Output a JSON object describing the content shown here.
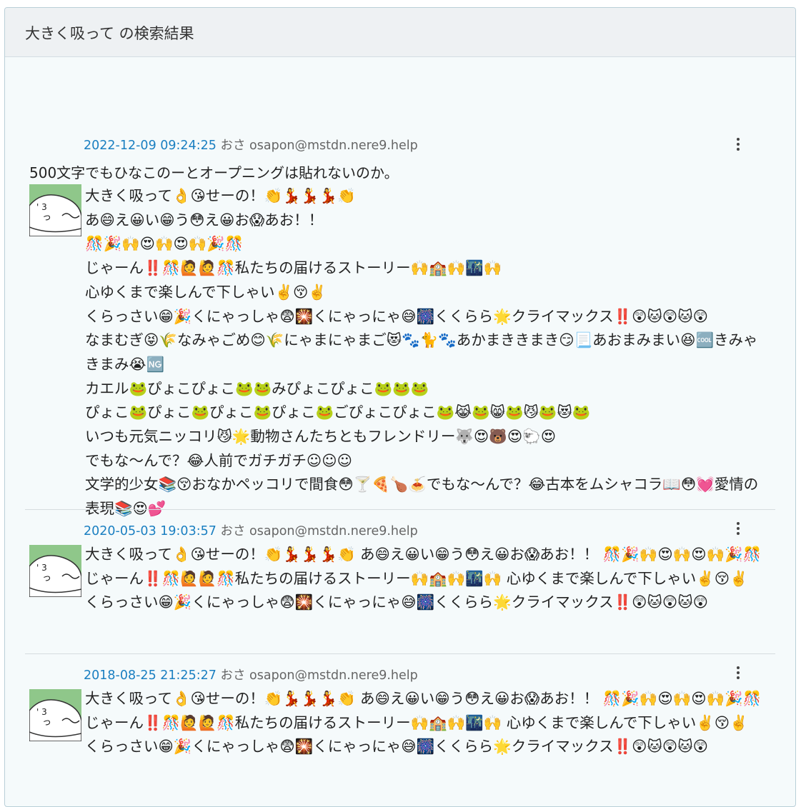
{
  "header": {
    "title": "大きく吸って の検索結果"
  },
  "posts": [
    {
      "date": "2022-12-09 09:24:25",
      "name": "おさ",
      "acct": "osapon@mstdn.nere9.help",
      "preline": "500文字でもひなこのーとオープニングは貼れないのか。",
      "body": "大きく吸って👌😘せーの！👏💃💃💃👏\nあ😄え😀い😁う😳え😀お😱あお！！\n🎊🎉🙌😍🙌😍🙌🎉🎊\nじゃーん‼️🎊🙋🙋🎊私たちの届けるストーリー🙌🏫🙌🌃🙌\n心ゆくまで楽しんで下しゃい✌️😚✌️\nくらっさい😁🎉くにゃっしゃ😨🎇くにゃっにゃ😅🎆くくらら🌟クライマックス‼️😲🐱😲🐱😲\nなまむぎ😝🌾なみゃごめ😊🌾にゃまにゃまご😻🐾🐈🐾あかまききまき😏📃あおまみまい😆🆒きみゃきまみ😭🆖\nカエル🐸ぴょこぴょこ🐸🐸みぴょこぴょこ🐸🐸🐸\nぴょこ🐸ぴょこ🐸ぴょこ🐸ぴょこ🐸ごぴょこぴょこ🐸😹🐸😸🐸😼🐸😻🐸\nいつも元気ニッコリ😼🌟動物さんたちともフレンドリー🐺😍🐻😍🐑😍\nでもな〜んで？😂人前でガチガチ☺☺☺\n文学的少女📚😚おなかペッコリで間食😳🍸🍕🍗🍝でもな〜んで？😂古本をムシャコラ📖😳💓愛情の表現📚😍💕"
    },
    {
      "date": "2020-05-03 19:03:57",
      "name": "おさ",
      "acct": "osapon@mstdn.nere9.help",
      "body": "大きく吸って👌😘せーの！👏💃💃💃👏 あ😄え😀い😁う😳え😀お😱あお！！ 🎊🎉🙌😍🙌😍🙌🎉🎊 じゃーん‼️🎊🙋🙋🎊私たちの届けるストーリー🙌🏫🙌🌃🙌 心ゆくまで楽しんで下しゃい✌️😚✌️ くらっさい😁🎉くにゃっしゃ😨🎇くにゃっにゃ😅🎆くくらら🌟クライマックス‼️😲🐱😲🐱😲"
    },
    {
      "date": "2018-08-25 21:25:27",
      "name": "おさ",
      "acct": "osapon@mstdn.nere9.help",
      "body": "大きく吸って👌😘せーの！👏💃💃💃👏 あ😄え😀い😁う😳え😀お😱あお！！ 🎊🎉🙌😍🙌😍🙌🎉🎊 じゃーん‼️🎊🙋🙋🎊私たちの届けるストーリー🙌🏫🙌🌃🙌 心ゆくまで楽しんで下しゃい✌️😚✌️ くらっさい😁🎉くにゃっしゃ😨🎇くにゃっにゃ😅🎆くくらら🌟クライマックス‼️😲🐱😲🐱😲"
    }
  ]
}
